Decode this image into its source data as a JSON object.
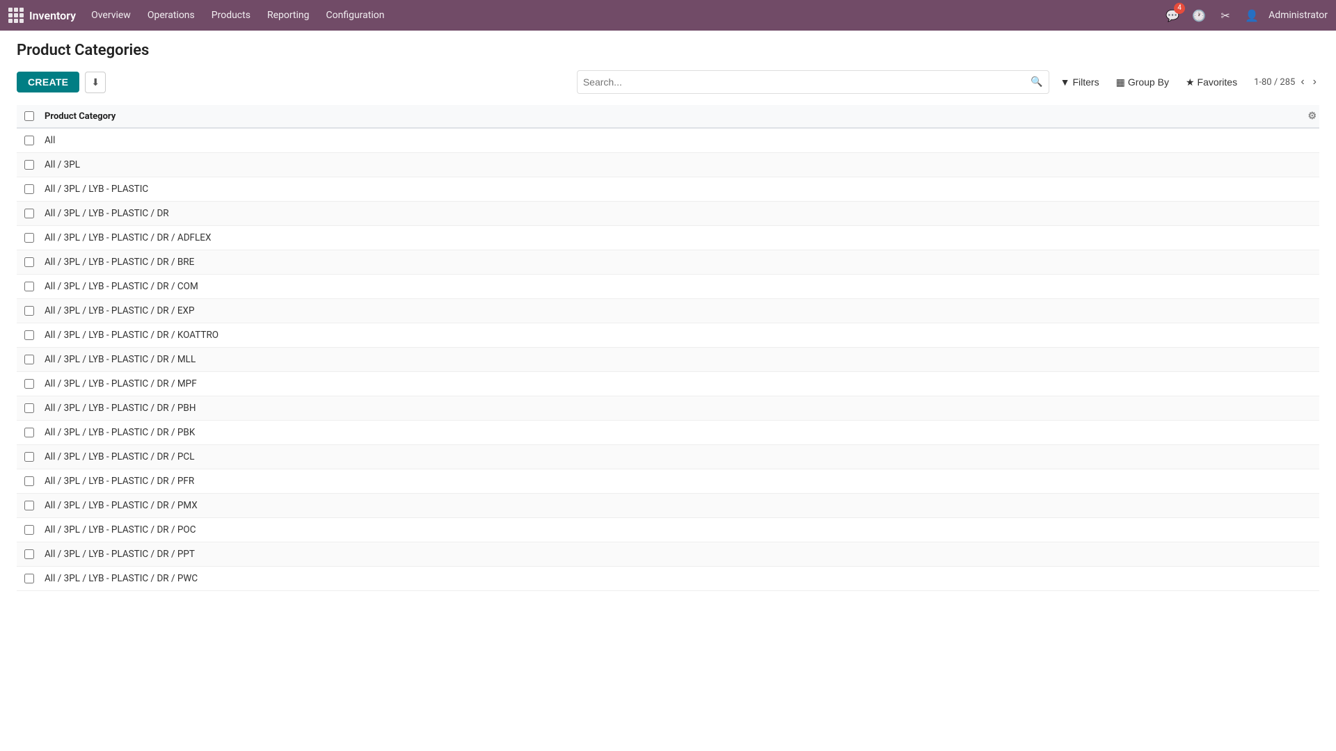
{
  "app": {
    "name": "Inventory",
    "nav_links": [
      "Overview",
      "Operations",
      "Products",
      "Reporting",
      "Configuration"
    ]
  },
  "navbar": {
    "badge_count": "4",
    "user": "Administrator"
  },
  "page": {
    "title": "Product Categories"
  },
  "toolbar": {
    "create_label": "CREATE",
    "search_placeholder": "Search...",
    "filters_label": "Filters",
    "group_by_label": "Group By",
    "favorites_label": "Favorites",
    "pagination": "1-80 / 285"
  },
  "table": {
    "header": "Product Category",
    "rows": [
      "All",
      "All / 3PL",
      "All / 3PL / LYB - PLASTIC",
      "All / 3PL / LYB - PLASTIC / DR",
      "All / 3PL / LYB - PLASTIC / DR / ADFLEX",
      "All / 3PL / LYB - PLASTIC / DR / BRE",
      "All / 3PL / LYB - PLASTIC / DR / COM",
      "All / 3PL / LYB - PLASTIC / DR / EXP",
      "All / 3PL / LYB - PLASTIC / DR / KOATTRO",
      "All / 3PL / LYB - PLASTIC / DR / MLL",
      "All / 3PL / LYB - PLASTIC / DR / MPF",
      "All / 3PL / LYB - PLASTIC / DR / PBH",
      "All / 3PL / LYB - PLASTIC / DR / PBK",
      "All / 3PL / LYB - PLASTIC / DR / PCL",
      "All / 3PL / LYB - PLASTIC / DR / PFR",
      "All / 3PL / LYB - PLASTIC / DR / PMX",
      "All / 3PL / LYB - PLASTIC / DR / POC",
      "All / 3PL / LYB - PLASTIC / DR / PPT",
      "All / 3PL / LYB - PLASTIC / DR / PWC"
    ]
  }
}
